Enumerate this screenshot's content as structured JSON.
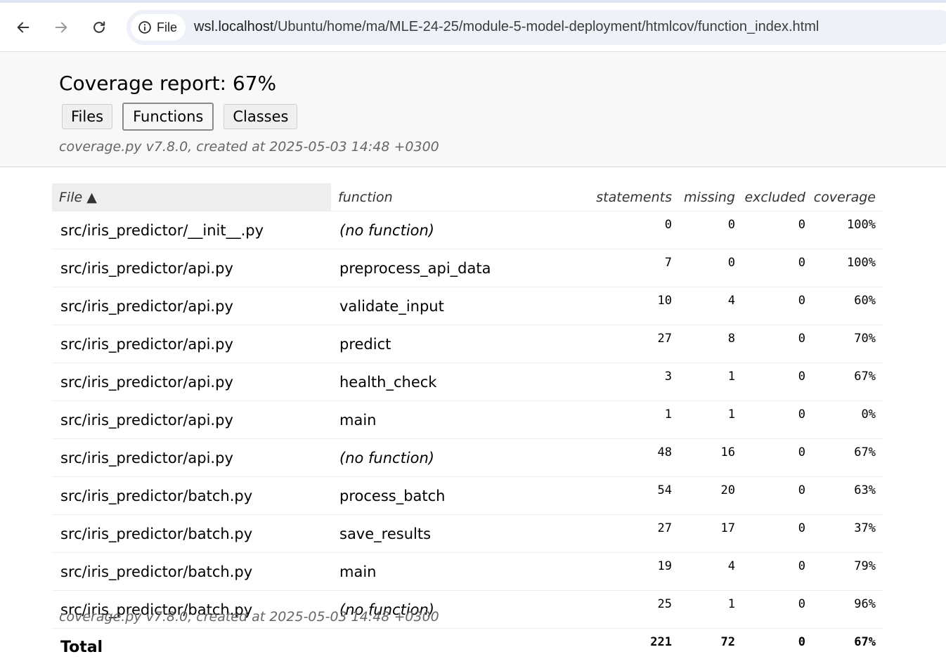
{
  "browser": {
    "chip_label": "File",
    "url_host": "wsl.localhost",
    "url_path": "/Ubuntu/home/ma/MLE-24-25/module-5-model-deployment/htmlcov/function_index.html"
  },
  "header": {
    "title": "Coverage report: 67%",
    "tabs": [
      "Files",
      "Functions",
      "Classes"
    ],
    "active_tab": "Functions",
    "created": "coverage.py v7.8.0, created at 2025-05-03 14:48 +0300"
  },
  "table": {
    "columns": {
      "file": "File ▲",
      "function": "function",
      "statements": "statements",
      "missing": "missing",
      "excluded": "excluded",
      "coverage": "coverage"
    },
    "rows": [
      {
        "file": "src/iris_predictor/__init__.py",
        "function": "(no function)",
        "statements": "0",
        "missing": "0",
        "excluded": "0",
        "coverage": "100%"
      },
      {
        "file": "src/iris_predictor/api.py",
        "function": "preprocess_api_data",
        "statements": "7",
        "missing": "0",
        "excluded": "0",
        "coverage": "100%"
      },
      {
        "file": "src/iris_predictor/api.py",
        "function": "validate_input",
        "statements": "10",
        "missing": "4",
        "excluded": "0",
        "coverage": "60%"
      },
      {
        "file": "src/iris_predictor/api.py",
        "function": "predict",
        "statements": "27",
        "missing": "8",
        "excluded": "0",
        "coverage": "70%"
      },
      {
        "file": "src/iris_predictor/api.py",
        "function": "health_check",
        "statements": "3",
        "missing": "1",
        "excluded": "0",
        "coverage": "67%"
      },
      {
        "file": "src/iris_predictor/api.py",
        "function": "main",
        "statements": "1",
        "missing": "1",
        "excluded": "0",
        "coverage": "0%"
      },
      {
        "file": "src/iris_predictor/api.py",
        "function": "(no function)",
        "statements": "48",
        "missing": "16",
        "excluded": "0",
        "coverage": "67%"
      },
      {
        "file": "src/iris_predictor/batch.py",
        "function": "process_batch",
        "statements": "54",
        "missing": "20",
        "excluded": "0",
        "coverage": "63%"
      },
      {
        "file": "src/iris_predictor/batch.py",
        "function": "save_results",
        "statements": "27",
        "missing": "17",
        "excluded": "0",
        "coverage": "37%"
      },
      {
        "file": "src/iris_predictor/batch.py",
        "function": "main",
        "statements": "19",
        "missing": "4",
        "excluded": "0",
        "coverage": "79%"
      },
      {
        "file": "src/iris_predictor/batch.py",
        "function": "(no function)",
        "statements": "25",
        "missing": "1",
        "excluded": "0",
        "coverage": "96%"
      }
    ],
    "total": {
      "label": "Total",
      "statements": "221",
      "missing": "72",
      "excluded": "0",
      "coverage": "67%"
    }
  },
  "footer": {
    "created": "coverage.py v7.8.0, created at 2025-05-03 14:48 +0300"
  }
}
